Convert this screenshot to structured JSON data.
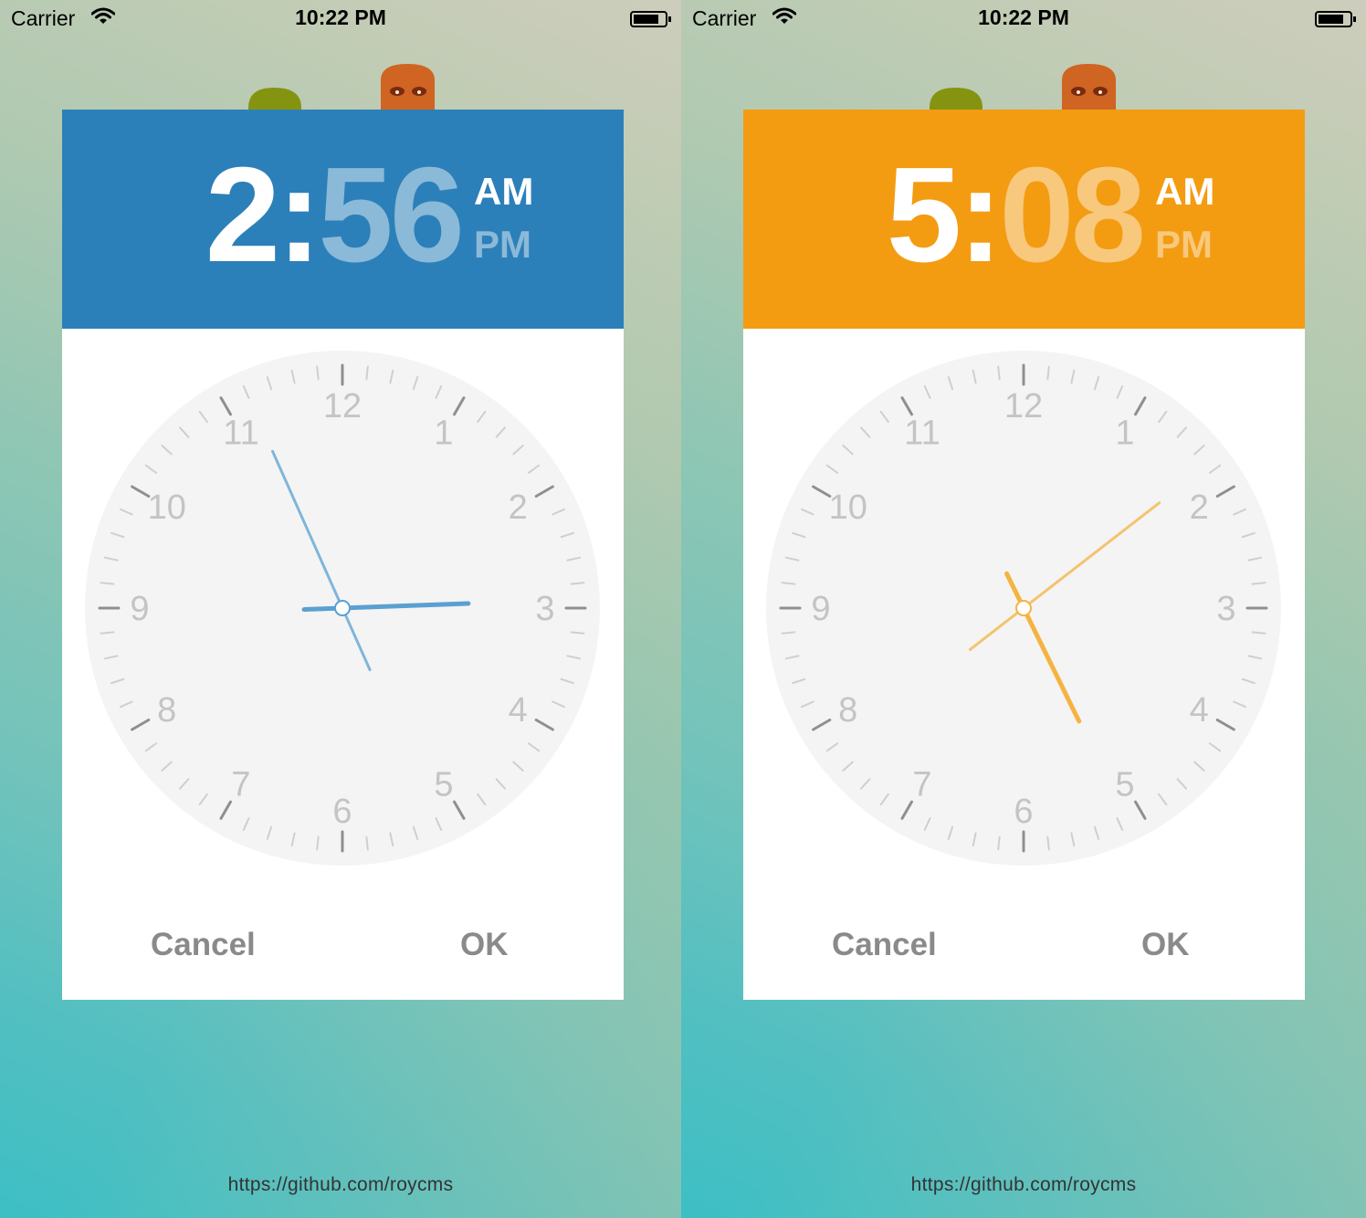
{
  "screens": [
    {
      "status_bar": {
        "carrier": "Carrier",
        "time": "10:22 PM",
        "icons": [
          "wifi-icon",
          "battery-icon"
        ]
      },
      "header": {
        "hours": "2",
        "separator": ":",
        "minutes": "56",
        "am_label": "AM",
        "pm_label": "PM",
        "selected_period": "AM"
      },
      "accent_color": "#2c80b9",
      "hand_color": "#5aa0d2",
      "clock": {
        "numbers": [
          "12",
          "1",
          "2",
          "3",
          "4",
          "5",
          "6",
          "7",
          "8",
          "9",
          "10",
          "11"
        ],
        "hour_value": 2.93,
        "minute_value": 56
      },
      "buttons": {
        "cancel": "Cancel",
        "ok": "OK"
      },
      "footer": "https://github.com/roycms"
    },
    {
      "status_bar": {
        "carrier": "Carrier",
        "time": "10:22 PM",
        "icons": [
          "wifi-icon",
          "battery-icon"
        ]
      },
      "header": {
        "hours": "5",
        "separator": ":",
        "minutes": "08",
        "am_label": "AM",
        "pm_label": "PM",
        "selected_period": "AM"
      },
      "accent_color": "#f39c12",
      "hand_color": "#f5b342",
      "clock": {
        "numbers": [
          "12",
          "1",
          "2",
          "3",
          "4",
          "5",
          "6",
          "7",
          "8",
          "9",
          "10",
          "11"
        ],
        "hour_value": 5.13,
        "minute_value": 8.7
      },
      "buttons": {
        "cancel": "Cancel",
        "ok": "OK"
      },
      "footer": "https://github.com/roycms"
    }
  ]
}
